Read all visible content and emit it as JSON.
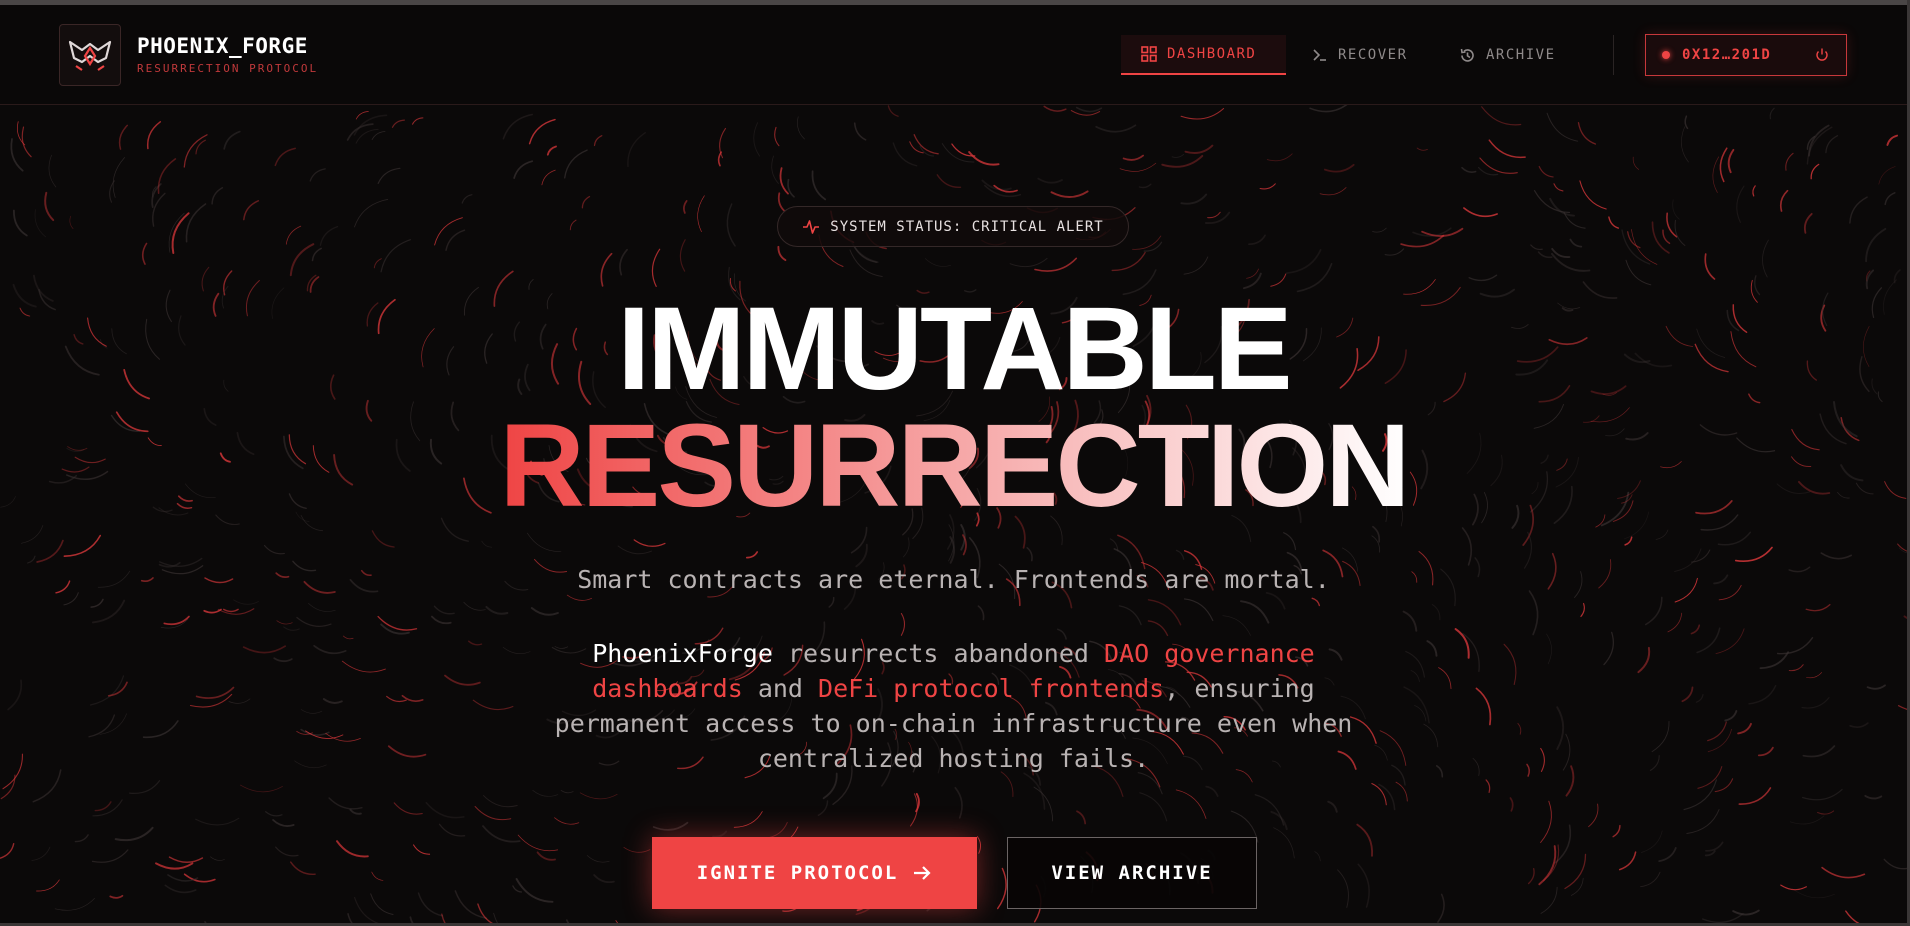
{
  "brand": {
    "name": "PHOENIX_FORGE",
    "subtitle": "RESURRECTION PROTOCOL",
    "logo_icon": "phoenix-logo-icon"
  },
  "nav": {
    "items": [
      {
        "label": "DASHBOARD",
        "icon": "grid-icon",
        "active": true
      },
      {
        "label": "RECOVER",
        "icon": "terminal-icon",
        "active": false
      },
      {
        "label": "ARCHIVE",
        "icon": "history-icon",
        "active": false
      }
    ]
  },
  "wallet": {
    "address": "0X12…201D",
    "status_icon": "status-dot",
    "action_icon": "power-icon"
  },
  "hero": {
    "status": "SYSTEM STATUS: CRITICAL ALERT",
    "status_icon": "activity-icon",
    "title_line1": "IMMUTABLE",
    "title_line2": "RESURRECTION",
    "tagline": "Smart contracts are eternal. Frontends are mortal.",
    "description": {
      "brand": "PhoenixForge",
      "t1": " resurrects abandoned ",
      "h1": "DAO governance dashboards",
      "t2": " and ",
      "h2": "DeFi protocol frontends",
      "t3": ", ensuring permanent access to on-chain infrastructure even when centralized hosting fails."
    }
  },
  "actions": {
    "primary": "IGNITE PROTOCOL",
    "primary_icon": "arrow-right-icon",
    "secondary": "VIEW ARCHIVE"
  },
  "colors": {
    "background": "#0b0909",
    "accent": "#ef4444",
    "text": "#b9b3b3",
    "heading": "#ffffff"
  }
}
